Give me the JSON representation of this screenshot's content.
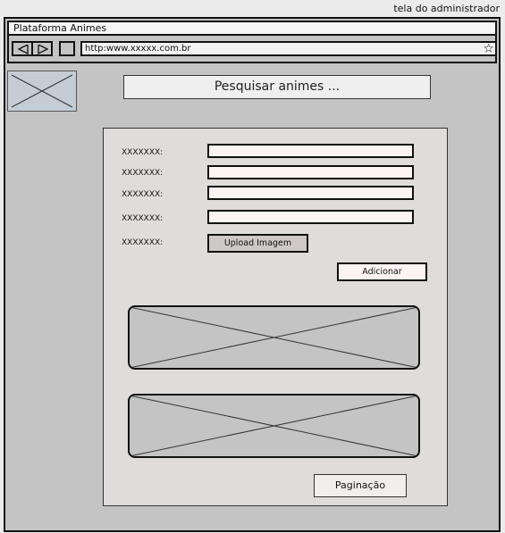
{
  "caption": "tela do administrador",
  "window": {
    "title": "Plataforma Animes",
    "address": "http:www.xxxxx.com.br",
    "star_glyph": "★",
    "back_icon": "triangle-left-icon",
    "forward_icon": "triangle-right-icon"
  },
  "search": {
    "label": "Pesquisar animes ..."
  },
  "form": {
    "fields": [
      {
        "label": "XXXXXXX:"
      },
      {
        "label": "XXXXXXX:"
      },
      {
        "label": "XXXXXXX:"
      },
      {
        "label": "XXXXXXX:"
      }
    ],
    "upload_label": "XXXXXXX:",
    "upload_button": "Upload Imagem",
    "add_button": "Adicionar"
  },
  "pagination": {
    "label": "Paginação"
  },
  "colors": {
    "window_bg": "#c4c4c4",
    "panel_bg": "#e0dcdc",
    "input_bg": "#fcf4f4",
    "border": "#111111"
  }
}
